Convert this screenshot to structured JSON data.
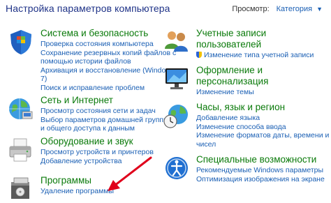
{
  "header": {
    "title": "Настройка параметров компьютера",
    "view_label": "Просмотр:",
    "view_value": "Категория"
  },
  "categories": [
    {
      "title": "Система и безопасность",
      "icon": "shield-flag-icon",
      "links": [
        "Проверка состояния компьютера",
        "Сохранение резервных копий файлов с",
        "помощью истории файлов",
        "Архивация и восстановление (Windows",
        "7)",
        "Поиск и исправление проблем"
      ]
    },
    {
      "title": "Сеть и Интернет",
      "icon": "globe-network-icon",
      "links": [
        "Просмотр состояния сети и задач",
        "Выбор параметров домашней группы",
        "и общего доступа к данным"
      ]
    },
    {
      "title": "Оборудование и звук",
      "icon": "printer-icon",
      "links": [
        "Просмотр устройств и принтеров",
        "Добавление устройства"
      ]
    },
    {
      "title": "Программы",
      "icon": "programs-icon",
      "links": [
        "Удаление программы"
      ]
    },
    {
      "title_lines": [
        "Учетные записи",
        "пользователей"
      ],
      "icon": "users-icon",
      "links": [
        "Изменение типа учетной записи"
      ]
    },
    {
      "title_lines": [
        "Оформление и",
        "персонализация"
      ],
      "icon": "monitor-icon",
      "links": [
        "Изменение темы"
      ]
    },
    {
      "title": "Часы, язык и регион",
      "icon": "clock-globe-icon",
      "links": [
        "Добавление языка",
        "Изменение способа ввода",
        "Изменение форматов даты, времени и",
        "чисел"
      ]
    },
    {
      "title": "Специальные возможности",
      "icon": "accessibility-icon",
      "links": [
        "Рекомендуемые Windows параметры",
        "Оптимизация изображения на экране"
      ]
    }
  ],
  "colors": {
    "heading": "#0a7a0a",
    "link": "#1a5fb4",
    "title": "#1e3287",
    "arrow": "#e0001b"
  }
}
